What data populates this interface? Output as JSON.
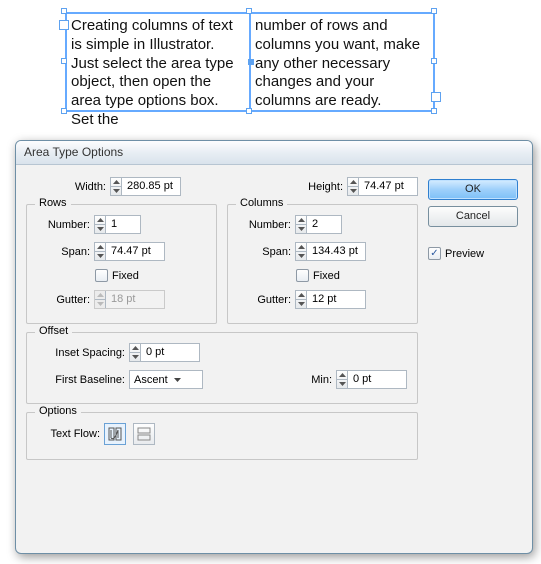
{
  "text_object": {
    "col1": "Creating columns of text is simple in Illustrator. Just select the area type object, then open the area type options box. Set the",
    "col2": "number of rows and columns you want, make any other necessary changes and your columns are ready."
  },
  "dialog": {
    "title": "Area Type Options",
    "width_label": "Width:",
    "width_value": "280.85 pt",
    "height_label": "Height:",
    "height_value": "74.47 pt",
    "rows": {
      "legend": "Rows",
      "number_label": "Number:",
      "number_value": "1",
      "span_label": "Span:",
      "span_value": "74.47 pt",
      "fixed_label": "Fixed",
      "gutter_label": "Gutter:",
      "gutter_value": "18 pt"
    },
    "columns": {
      "legend": "Columns",
      "number_label": "Number:",
      "number_value": "2",
      "span_label": "Span:",
      "span_value": "134.43 pt",
      "fixed_label": "Fixed",
      "gutter_label": "Gutter:",
      "gutter_value": "12 pt"
    },
    "offset": {
      "legend": "Offset",
      "inset_label": "Inset Spacing:",
      "inset_value": "0 pt",
      "baseline_label": "First Baseline:",
      "baseline_value": "Ascent",
      "min_label": "Min:",
      "min_value": "0 pt"
    },
    "options": {
      "legend": "Options",
      "textflow_label": "Text Flow:"
    },
    "buttons": {
      "ok": "OK",
      "cancel": "Cancel",
      "preview": "Preview"
    }
  }
}
